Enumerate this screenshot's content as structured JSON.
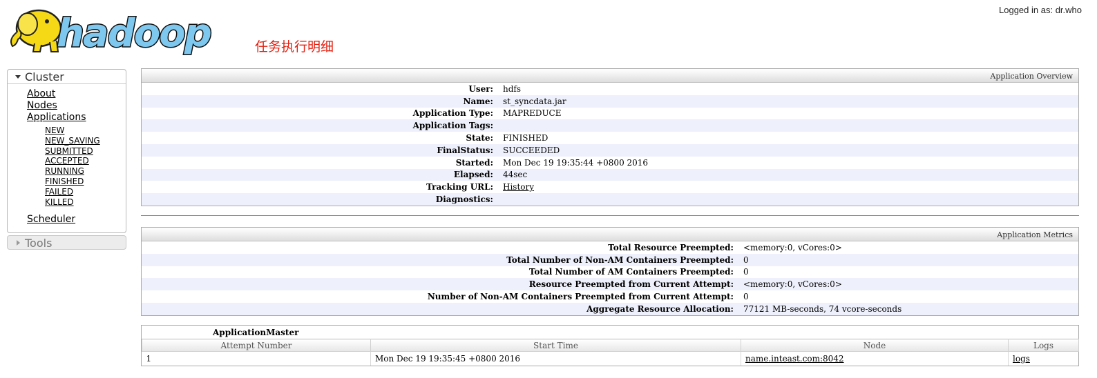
{
  "header": {
    "logo_text": "hadoop",
    "page_heading": "任务执行明细",
    "login_text": "Logged in as: dr.who"
  },
  "sidebar": {
    "cluster_label": "Cluster",
    "about": "About",
    "nodes": "Nodes",
    "applications": "Applications",
    "states": [
      "NEW",
      "NEW_SAVING",
      "SUBMITTED",
      "ACCEPTED",
      "RUNNING",
      "FINISHED",
      "FAILED",
      "KILLED"
    ],
    "scheduler": "Scheduler",
    "tools_label": "Tools"
  },
  "overview": {
    "title": "Application Overview",
    "rows": [
      {
        "label": "User:",
        "value": "hdfs"
      },
      {
        "label": "Name:",
        "value": "st_syncdata.jar"
      },
      {
        "label": "Application Type:",
        "value": "MAPREDUCE"
      },
      {
        "label": "Application Tags:",
        "value": ""
      },
      {
        "label": "State:",
        "value": "FINISHED"
      },
      {
        "label": "FinalStatus:",
        "value": "SUCCEEDED"
      },
      {
        "label": "Started:",
        "value": "Mon Dec 19 19:35:44 +0800 2016"
      },
      {
        "label": "Elapsed:",
        "value": "44sec"
      },
      {
        "label": "Tracking URL:",
        "value": "History"
      },
      {
        "label": "Diagnostics:",
        "value": ""
      }
    ]
  },
  "metrics": {
    "title": "Application Metrics",
    "rows": [
      {
        "label": "Total Resource Preempted:",
        "value": "<memory:0, vCores:0>"
      },
      {
        "label": "Total Number of Non-AM Containers Preempted:",
        "value": "0"
      },
      {
        "label": "Total Number of AM Containers Preempted:",
        "value": "0"
      },
      {
        "label": "Resource Preempted from Current Attempt:",
        "value": "<memory:0, vCores:0>"
      },
      {
        "label": "Number of Non-AM Containers Preempted from Current Attempt:",
        "value": "0"
      },
      {
        "label": "Aggregate Resource Allocation:",
        "value": "77121 MB-seconds, 74 vcore-seconds"
      }
    ]
  },
  "app_master": {
    "caption": "ApplicationMaster",
    "columns": [
      "Attempt Number",
      "Start Time",
      "Node",
      "Logs"
    ],
    "row": {
      "attempt": "1",
      "start_time": "Mon Dec 19 19:35:45 +0800 2016",
      "node": "name.inteast.com:8042",
      "logs": "logs"
    }
  },
  "colors": {
    "heading_red": "#e41e0e",
    "elephant_yellow": "#f5d916",
    "logo_blue": "#7ec8f0",
    "row_stripe": "#eef0fb"
  }
}
